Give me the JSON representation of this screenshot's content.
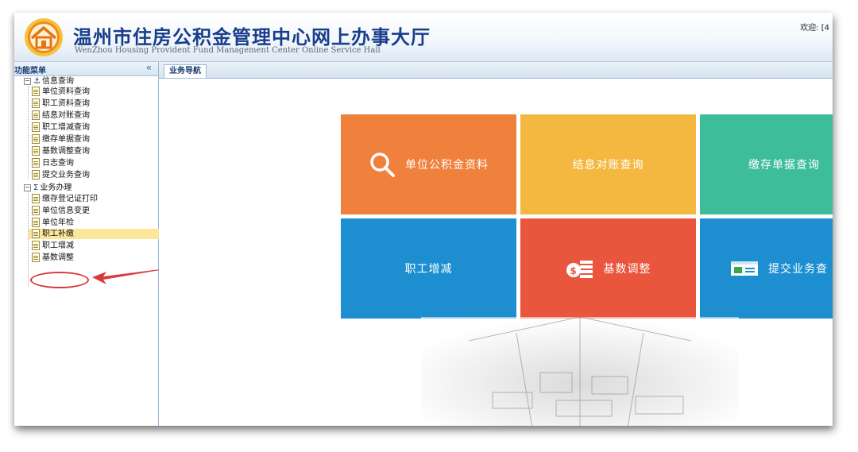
{
  "header": {
    "title_cn": "温州市住房公积金管理中心网上办事大厅",
    "title_en": "WenZhou Housing Provident Fund Management Center Online Service Hall",
    "welcome": "欢迎: [4"
  },
  "sidebar": {
    "title": "功能菜单",
    "collapse_glyph": "«",
    "groups": [
      {
        "label": "信息查询",
        "items": [
          "单位资料查询",
          "职工资料查询",
          "结息对账查询",
          "职工增减查询",
          "缴存单据查询",
          "基数调整查询",
          "日志查询",
          "提交业务查询"
        ]
      },
      {
        "label": "业务办理",
        "items": [
          "缴存登记证打印",
          "单位信息变更",
          "单位年检",
          "职工补缴",
          "职工增减",
          "基数调整"
        ]
      }
    ],
    "selected_item": "职工补缴",
    "annotated_item": "基数调整"
  },
  "tabs": [
    {
      "label": "业务导航",
      "active": true
    }
  ],
  "tiles": [
    {
      "label": "单位公积金资料",
      "color": "#f0813c",
      "icon": "search-icon"
    },
    {
      "label": "结息对账查询",
      "color": "#f4b841",
      "icon": null
    },
    {
      "label": "缴存单据查询",
      "color": "#3ebd9a",
      "icon": null
    },
    {
      "label": "职工增减",
      "color": "#1d8fd0",
      "icon": null
    },
    {
      "label": "基数调整",
      "color": "#ea553e",
      "icon": "money-stack-icon"
    },
    {
      "label": "提交业务查",
      "color": "#1d8fd0",
      "icon": "card-icon"
    }
  ],
  "colors": {
    "title": "#183e8c",
    "selected_row": "#fce69a",
    "annotation": "#d83a3a"
  }
}
